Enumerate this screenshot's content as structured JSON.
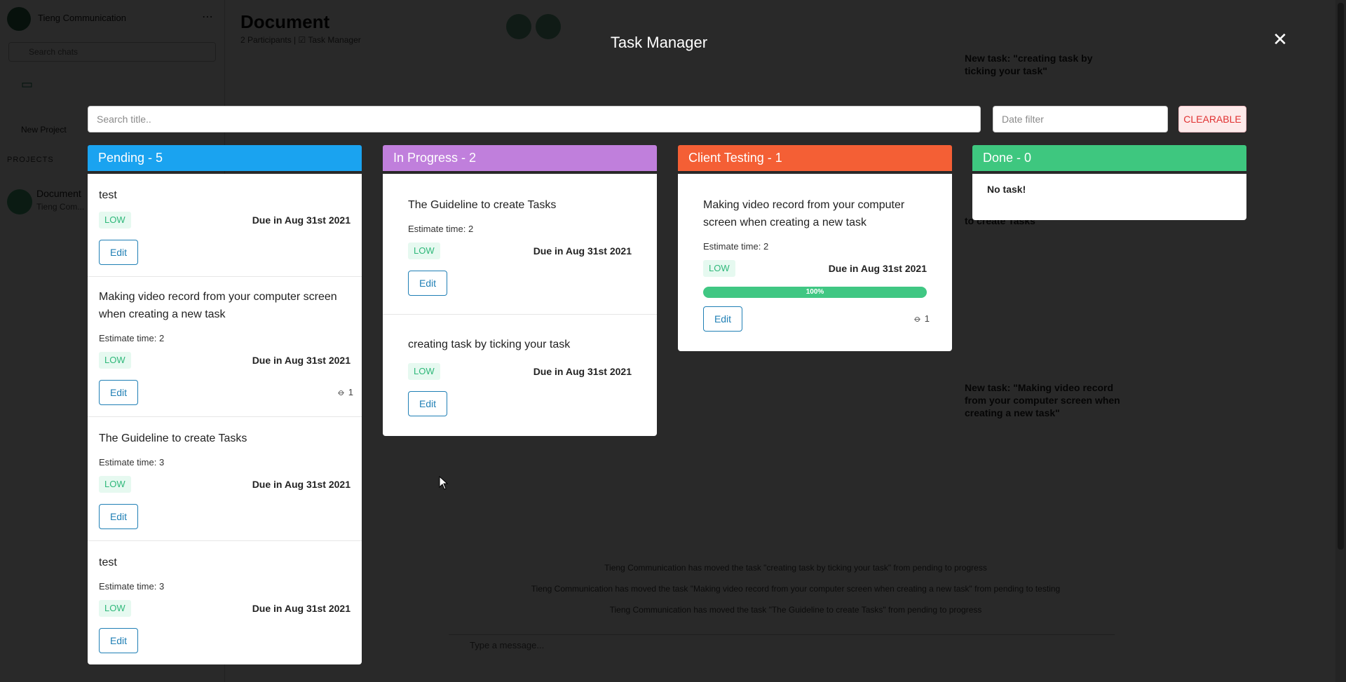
{
  "background": {
    "org_name": "Tieng Communication",
    "search_placeholder": "Search chats",
    "new_project": "New Project",
    "section": "PROJECTS",
    "project_name": "Document",
    "project_sub": "Tieng Com...",
    "page_title": "Document",
    "page_sub": "2 Participants  |  ☑ Task Manager",
    "feed_1": "New task: \"creating task by ticking your task\"",
    "feed_2": "to create Tasks\"",
    "feed_3": "New task: \"Making video record from your computer screen when creating a new task\"",
    "footer_lines": [
      "Tieng Communication has moved the task \"creating task by ticking your task\" from pending to progress",
      "Tieng Communication has moved the task \"Making video record from your computer screen when creating a new task\" from pending to testing",
      "Tieng Communication has moved the task \"The Guideline to create Tasks\" from pending to progress"
    ],
    "message_placeholder": "Type a message..."
  },
  "modal": {
    "title": "Task Manager",
    "close_icon": "✕",
    "search_placeholder": "Search title..",
    "date_placeholder": "Date filter",
    "clear_label": "CLEARABLE"
  },
  "columns": [
    {
      "label": "Pending - 5",
      "color": "#1aa3f0",
      "cards": [
        {
          "title": "test",
          "estimate": "",
          "priority": "LOW",
          "due": "Due in Aug 31st 2021",
          "edit": "Edit",
          "attachments": ""
        },
        {
          "title": "Making video record from your computer screen when creating a new task",
          "estimate": "Estimate time: 2",
          "priority": "LOW",
          "due": "Due in Aug 31st 2021",
          "edit": "Edit",
          "attachments": "1"
        },
        {
          "title": "The Guideline to create Tasks",
          "estimate": "Estimate time: 3",
          "priority": "LOW",
          "due": "Due in Aug 31st 2021",
          "edit": "Edit",
          "attachments": ""
        },
        {
          "title": "test",
          "estimate": "Estimate time: 3",
          "priority": "LOW",
          "due": "Due in Aug 31st 2021",
          "edit": "Edit",
          "attachments": ""
        }
      ]
    },
    {
      "label": "In Progress - 2",
      "color": "#c07fdc",
      "cards": [
        {
          "title": "The Guideline to create Tasks",
          "estimate": "Estimate time: 2",
          "priority": "LOW",
          "due": "Due in Aug 31st 2021",
          "edit": "Edit"
        },
        {
          "title": "creating task by ticking your task",
          "estimate": "",
          "priority": "LOW",
          "due": "Due in Aug 31st 2021",
          "edit": "Edit"
        }
      ]
    },
    {
      "label": "Client Testing - 1",
      "color": "#f45f35",
      "cards": [
        {
          "title": "Making video record from your computer screen when creating a new task",
          "estimate": "Estimate time: 2",
          "priority": "LOW",
          "due": "Due in Aug 31st 2021",
          "progress": 1.0,
          "progress_label": "100%",
          "edit": "Edit",
          "attachments": "1"
        }
      ]
    },
    {
      "label": "Done - 0",
      "color": "#3ec77f",
      "empty_text": "No task!"
    }
  ],
  "icons": {
    "close": "close-icon",
    "attachment": "paperclip-icon"
  }
}
